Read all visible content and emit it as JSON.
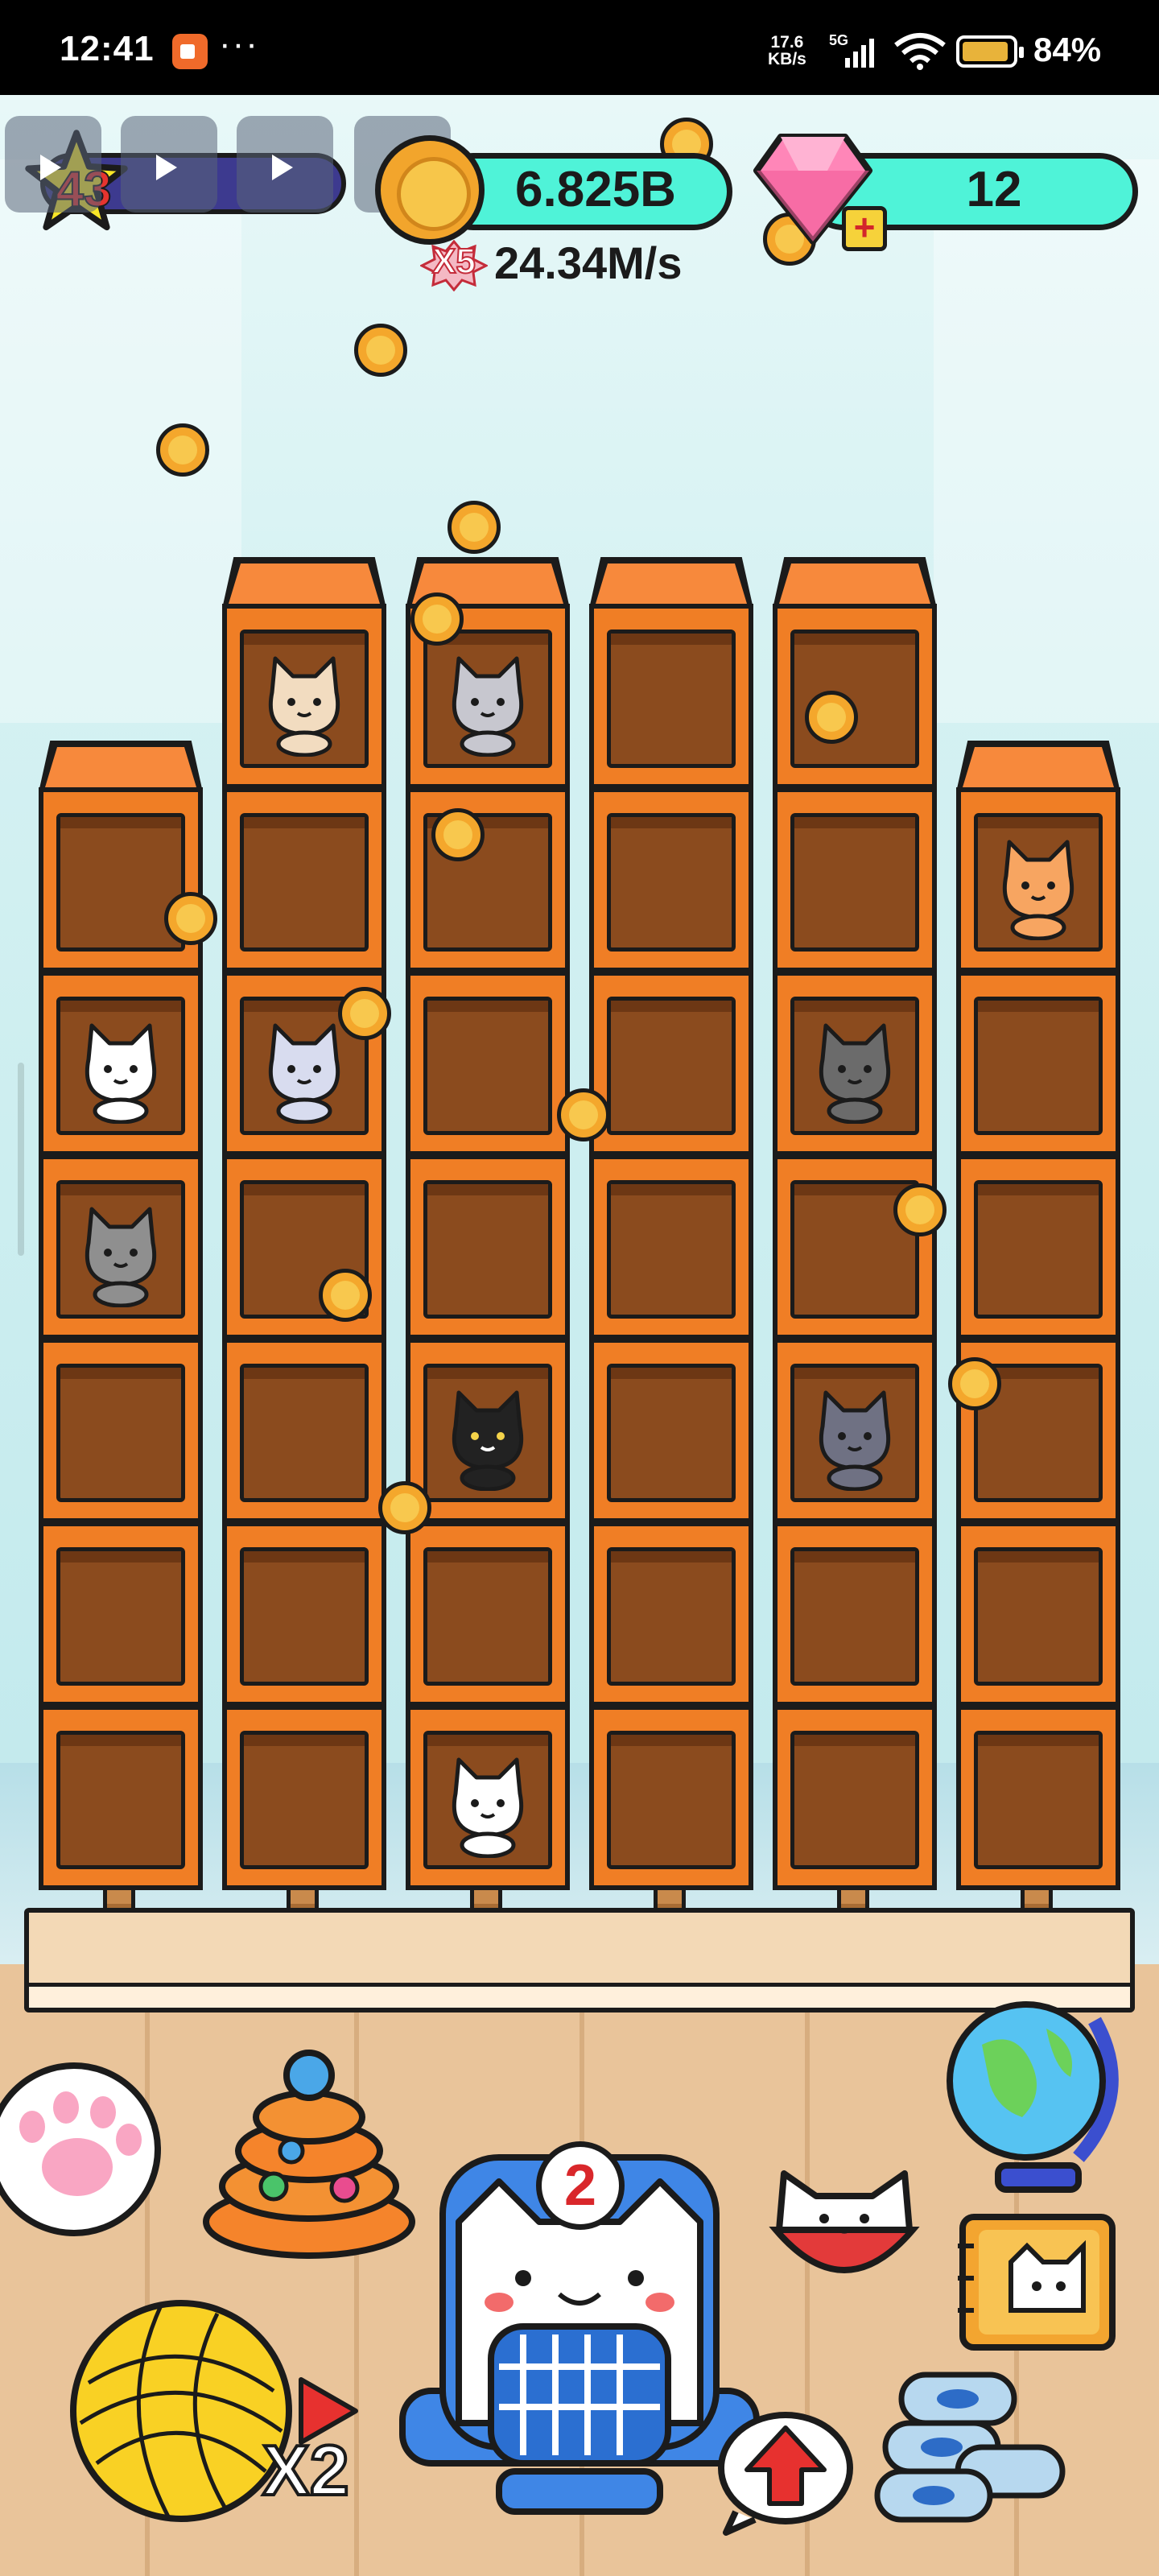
{
  "status_bar": {
    "time": "12:41",
    "dots": "···",
    "net_speed_value": "17.6",
    "net_speed_unit": "KB/s",
    "network": "5G",
    "battery": "84%"
  },
  "hud": {
    "level": "43",
    "coins": "6.825B",
    "multiplier": "X5",
    "rate": "24.34M/s",
    "gems": "12",
    "gem_add": "+"
  },
  "bottom": {
    "carrier_count": "2",
    "boost_label": "X2"
  },
  "shelf": {
    "columns": 6,
    "cats": [
      {
        "col": 1,
        "row": 0,
        "kind": "bengal-cat"
      },
      {
        "col": 2,
        "row": 0,
        "kind": "beanie-cat"
      },
      {
        "col": 5,
        "row": 1,
        "kind": "tiger-cat"
      },
      {
        "col": 0,
        "row": 2,
        "kind": "maid-cat"
      },
      {
        "col": 1,
        "row": 2,
        "kind": "sleepy-wizard-cat"
      },
      {
        "col": 4,
        "row": 2,
        "kind": "samurai-cat"
      },
      {
        "col": 0,
        "row": 3,
        "kind": "ninja-cat"
      },
      {
        "col": 2,
        "row": 4,
        "kind": "witch-cat"
      },
      {
        "col": 4,
        "row": 4,
        "kind": "nurse-cat"
      },
      {
        "col": 2,
        "row": 6,
        "kind": "calico-cat"
      }
    ]
  },
  "colors": {
    "hud_bar": "#4ff3d8",
    "shelf_orange": "#f07e25",
    "shelf_inner": "#8b4b1e",
    "coin": "#f4a72c",
    "outline": "#1b1b1b"
  }
}
